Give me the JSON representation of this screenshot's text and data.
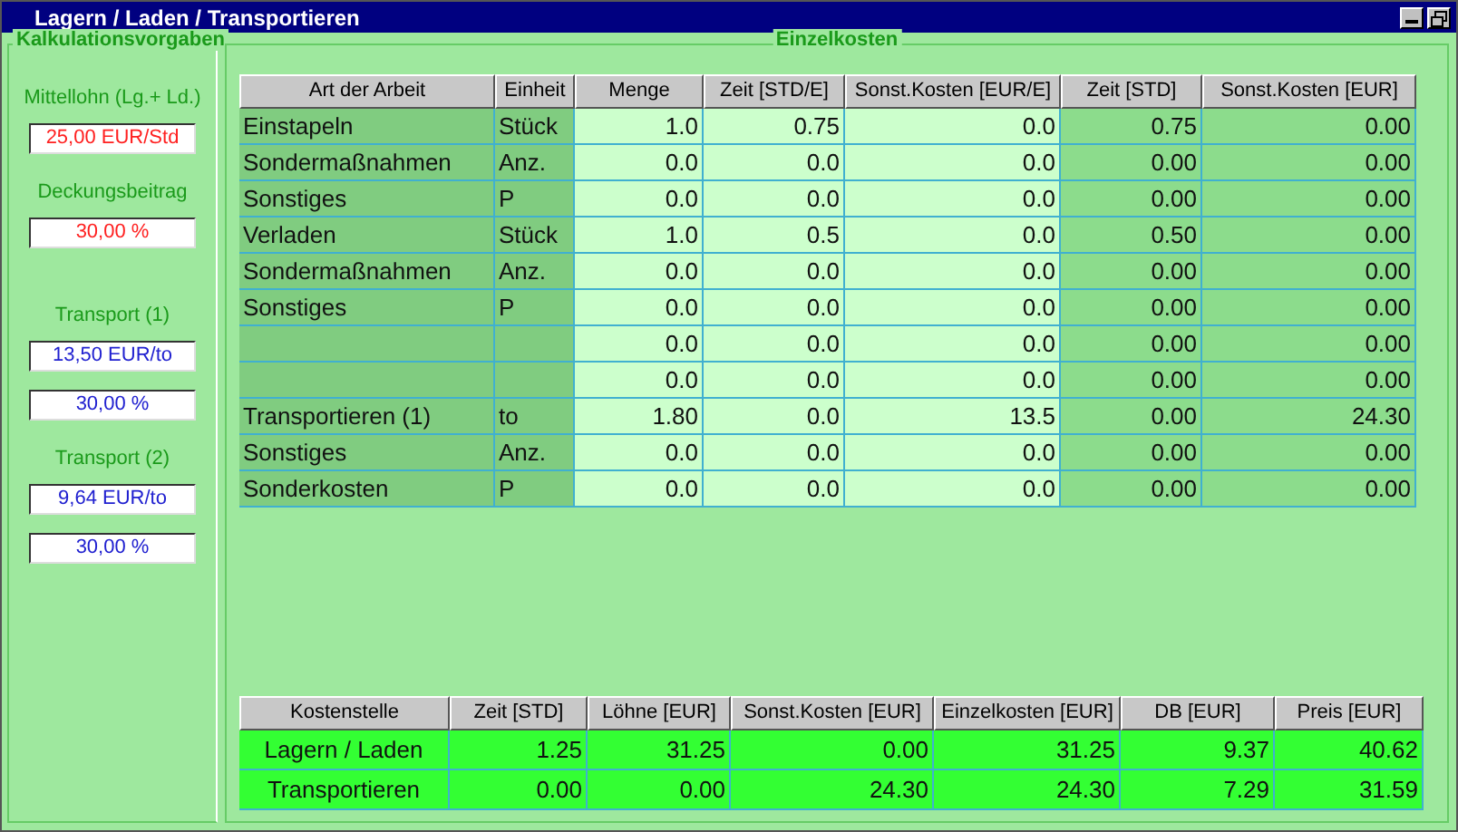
{
  "window": {
    "title": "Lagern / Laden / Transportieren"
  },
  "settings": {
    "title": "Kalkulationsvorgaben",
    "items": [
      {
        "kind": "label",
        "text": "Mittellohn (Lg.+ Ld.)"
      },
      {
        "kind": "field",
        "value": "25,00 EUR/Std",
        "color": "#ff2020"
      },
      {
        "kind": "label",
        "text": "Deckungsbeitrag"
      },
      {
        "kind": "field",
        "value": "30,00 %",
        "color": "#ff2020"
      },
      {
        "kind": "gap"
      },
      {
        "kind": "label",
        "text": "Transport (1)"
      },
      {
        "kind": "field",
        "value": "13,50 EUR/to",
        "color": "#2020d0"
      },
      {
        "kind": "field",
        "value": "30,00 %",
        "color": "#2020d0"
      },
      {
        "kind": "label",
        "text": "Transport (2)"
      },
      {
        "kind": "field",
        "value": "9,64 EUR/to",
        "color": "#2020d0"
      },
      {
        "kind": "field",
        "value": "30,00 %",
        "color": "#2020d0"
      }
    ]
  },
  "costs": {
    "title": "Einzelkosten",
    "columns": [
      "Art der Arbeit",
      "Einheit",
      "Menge",
      "Zeit [STD/E]",
      "Sonst.Kosten [EUR/E]",
      "Zeit [STD]",
      "Sonst.Kosten [EUR]"
    ],
    "rows": [
      [
        "Einstapeln",
        "Stück",
        "1.0",
        "0.75",
        "0.0",
        "0.75",
        "0.00"
      ],
      [
        "Sondermaßnahmen",
        "Anz.",
        "0.0",
        "0.0",
        "0.0",
        "0.00",
        "0.00"
      ],
      [
        "Sonstiges",
        "P",
        "0.0",
        "0.0",
        "0.0",
        "0.00",
        "0.00"
      ],
      [
        "Verladen",
        "Stück",
        "1.0",
        "0.5",
        "0.0",
        "0.50",
        "0.00"
      ],
      [
        "Sondermaßnahmen",
        "Anz.",
        "0.0",
        "0.0",
        "0.0",
        "0.00",
        "0.00"
      ],
      [
        "Sonstiges",
        "P",
        "0.0",
        "0.0",
        "0.0",
        "0.00",
        "0.00"
      ],
      [
        "",
        "",
        "0.0",
        "0.0",
        "0.0",
        "0.00",
        "0.00"
      ],
      [
        "",
        "",
        "0.0",
        "0.0",
        "0.0",
        "0.00",
        "0.00"
      ],
      [
        "Transportieren (1)",
        "to",
        "1.80",
        "0.0",
        "13.5",
        "0.00",
        "24.30"
      ],
      [
        "Sonstiges",
        "Anz.",
        "0.0",
        "0.0",
        "0.0",
        "0.00",
        "0.00"
      ],
      [
        "Sonderkosten",
        "P",
        "0.0",
        "0.0",
        "0.0",
        "0.00",
        "0.00"
      ]
    ]
  },
  "summary": {
    "columns": [
      "Kostenstelle",
      "Zeit [STD]",
      "Löhne [EUR]",
      "Sonst.Kosten [EUR]",
      "Einzelkosten [EUR]",
      "DB [EUR]",
      "Preis [EUR]"
    ],
    "rows": [
      [
        "Lagern / Laden",
        "1.25",
        "31.25",
        "0.00",
        "31.25",
        "9.37",
        "40.62"
      ],
      [
        "Transportieren",
        "0.00",
        "0.00",
        "24.30",
        "24.30",
        "7.29",
        "31.59"
      ]
    ]
  }
}
